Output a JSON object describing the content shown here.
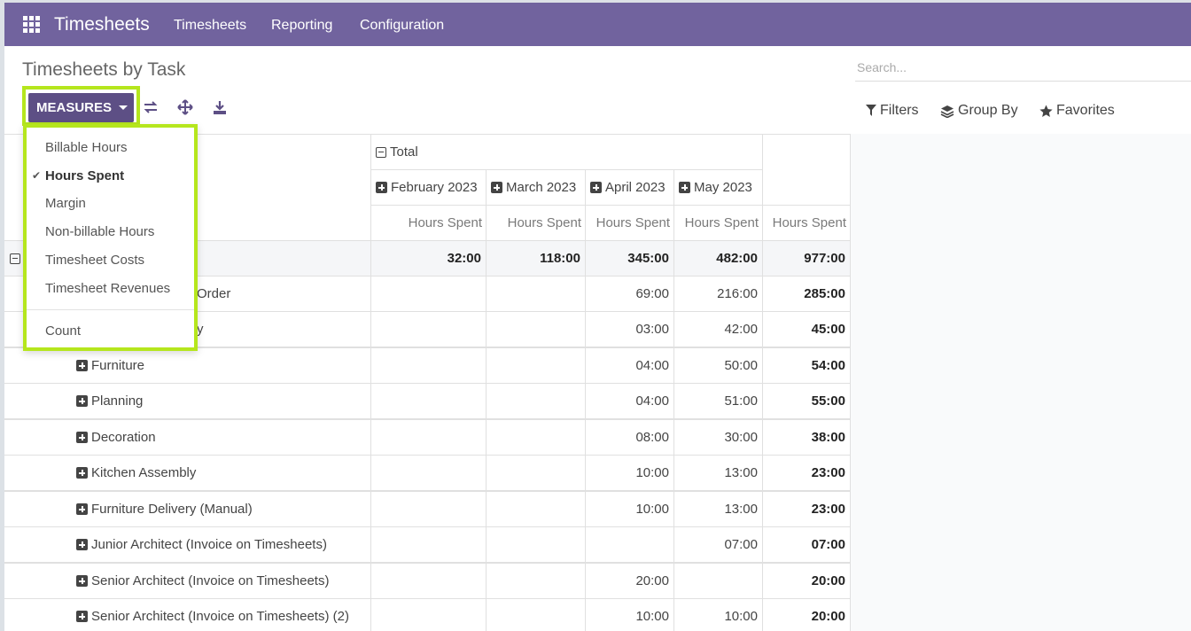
{
  "navbar": {
    "app_title": "Timesheets",
    "menu": [
      "Timesheets",
      "Reporting",
      "Configuration"
    ]
  },
  "control_panel": {
    "title": "Timesheets by Task",
    "search_placeholder": "Search...",
    "measures_label": "MEASURES",
    "filters_label": "Filters",
    "group_by_label": "Group By",
    "favorites_label": "Favorites"
  },
  "measures_menu": {
    "items": [
      "Billable Hours",
      "Hours Spent",
      "Margin",
      "Non-billable Hours",
      "Timesheet Costs",
      "Timesheet Revenues"
    ],
    "checked_item": "Hours Spent",
    "count_label": "Count"
  },
  "pivot": {
    "col_group_label": "Total",
    "months": [
      "February 2023",
      "March 2023",
      "April 2023",
      "May 2023"
    ],
    "measure_label": "Hours Spent",
    "total_row": {
      "values": [
        "32:00",
        "118:00",
        "345:00",
        "482:00"
      ],
      "total": "977:00"
    },
    "rows": [
      {
        "label_visible": "Order",
        "values": [
          "",
          "",
          "69:00",
          "216:00"
        ],
        "total": "285:00"
      },
      {
        "label_visible": "y",
        "values": [
          "",
          "",
          "03:00",
          "42:00"
        ],
        "total": "45:00"
      },
      {
        "label": "Furniture",
        "values": [
          "",
          "",
          "04:00",
          "50:00"
        ],
        "total": "54:00"
      },
      {
        "label": "Planning",
        "values": [
          "",
          "",
          "04:00",
          "51:00"
        ],
        "total": "55:00"
      },
      {
        "label": "Decoration",
        "values": [
          "",
          "",
          "08:00",
          "30:00"
        ],
        "total": "38:00"
      },
      {
        "label": "Kitchen Assembly",
        "values": [
          "",
          "",
          "10:00",
          "13:00"
        ],
        "total": "23:00"
      },
      {
        "label": "Furniture Delivery (Manual)",
        "values": [
          "",
          "",
          "10:00",
          "13:00"
        ],
        "total": "23:00"
      },
      {
        "label": "Junior Architect (Invoice on Timesheets)",
        "values": [
          "",
          "",
          "",
          "07:00"
        ],
        "total": "07:00"
      },
      {
        "label": "Senior Architect (Invoice on Timesheets)",
        "values": [
          "",
          "",
          "20:00",
          ""
        ],
        "total": "20:00"
      },
      {
        "label": "Senior Architect (Invoice on Timesheets) (2)",
        "values": [
          "",
          "",
          "10:00",
          "10:00"
        ],
        "total": "20:00"
      }
    ]
  },
  "colors": {
    "navbar": "#71639e",
    "primary_button": "#5d4f85",
    "highlight": "#b5e61d"
  },
  "icons": [
    "apps-icon",
    "flip-axis-icon",
    "expand-all-icon",
    "download-icon",
    "filter-icon",
    "layers-icon",
    "star-icon",
    "check-icon",
    "plus-square-icon",
    "minus-square-icon"
  ]
}
